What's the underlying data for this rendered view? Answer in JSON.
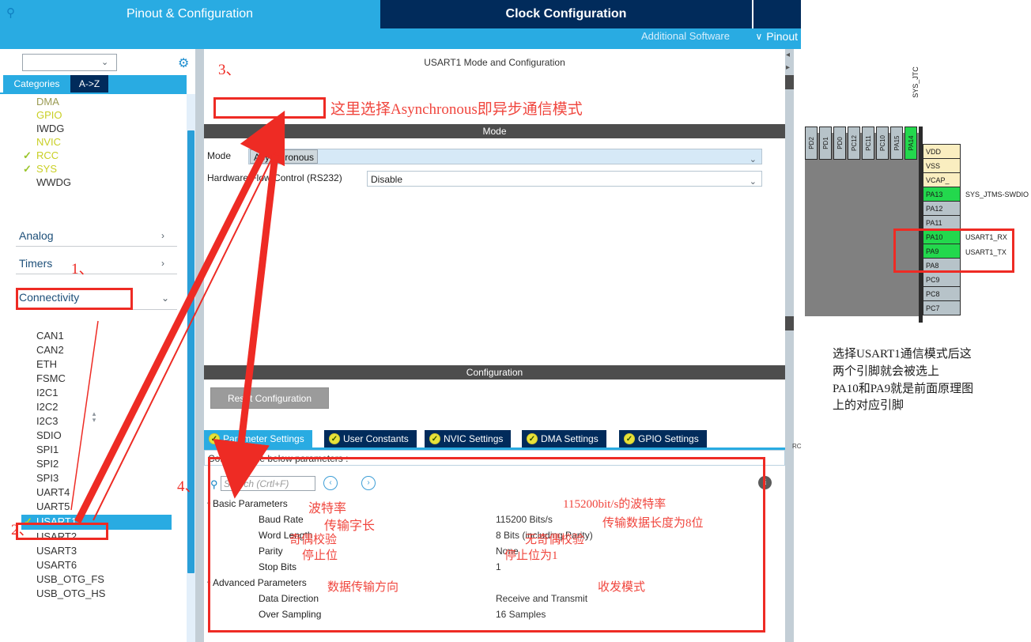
{
  "header": {
    "tabs": [
      {
        "label": "Pinout & Configuration",
        "active": true
      },
      {
        "label": "Clock Configuration",
        "active": false
      }
    ],
    "additional_software": "Additional Software",
    "pinout_dropdown": "Pinout",
    "chevron": "∨",
    "accent_blue": "#29ABE2",
    "dark_navy": "#012B5B"
  },
  "sidebar": {
    "search_icon": "search-icon",
    "search_value": "",
    "search_chevron": "⌄",
    "gear_icon": "gear-icon",
    "tabs": [
      {
        "label": "Categories",
        "active": true
      },
      {
        "label": "A->Z",
        "active": false
      }
    ],
    "peripherals": [
      {
        "label": "DMA",
        "used": false,
        "checked": false
      },
      {
        "label": "GPIO",
        "used": true,
        "checked": false
      },
      {
        "label": "IWDG",
        "used": false,
        "checked": false
      },
      {
        "label": "NVIC",
        "used": true,
        "checked": false
      },
      {
        "label": "RCC",
        "used": true,
        "checked": true
      },
      {
        "label": "SYS",
        "used": true,
        "checked": true
      },
      {
        "label": "WWDG",
        "used": false,
        "checked": false
      }
    ],
    "groups": [
      {
        "label": "Analog",
        "expanded": false,
        "chevron": "›"
      },
      {
        "label": "Timers",
        "expanded": false,
        "chevron": "›"
      },
      {
        "label": "Connectivity",
        "expanded": true,
        "chevron": "⌄"
      }
    ],
    "connectivity_items": [
      "CAN1",
      "CAN2",
      "ETH",
      "FSMC",
      "I2C1",
      "I2C2",
      "I2C3",
      "SDIO",
      "SPI1",
      "SPI2",
      "SPI3",
      "UART4",
      "UART5"
    ],
    "connectivity_selected": {
      "label": "USART1",
      "checked": true,
      "check_glyph": "✓"
    },
    "connectivity_items_after": [
      "USART2",
      "USART3",
      "USART6",
      "USB_OTG_FS",
      "USB_OTG_HS"
    ],
    "check_glyph": "✓"
  },
  "center": {
    "mode_title": "USART1 Mode and Configuration",
    "band_mode": "Mode",
    "band_config": "Configuration",
    "mode_rows": [
      {
        "label": "Mode",
        "value": "Asynchronous",
        "chevron": "⌄"
      },
      {
        "label": "Hardware Flow Control (RS232)",
        "value": "Disable",
        "chevron": "⌄"
      }
    ],
    "reset_button": "Reset Configuration",
    "config_tabs": [
      {
        "label": "Parameter Settings",
        "active": true,
        "tick": "✓"
      },
      {
        "label": "User Constants",
        "active": false,
        "tick": "✓"
      },
      {
        "label": "NVIC Settings",
        "active": false,
        "tick": "✓"
      },
      {
        "label": "DMA Settings",
        "active": false,
        "tick": "✓"
      },
      {
        "label": "GPIO Settings",
        "active": false,
        "tick": "✓"
      }
    ],
    "configure_bar": "Configure the below parameters :",
    "search_placeholder": "Search (Crtl+F)",
    "search_icon": "search-icon",
    "prev_icon": "‹",
    "next_icon": "›",
    "info_icon": "i",
    "param_groups": [
      {
        "name": "Basic Parameters",
        "chevron": "⌄",
        "rows": [
          {
            "name": "Baud Rate",
            "value": "115200 Bits/s"
          },
          {
            "name": "Word Length",
            "value": "8 Bits (including Parity)"
          },
          {
            "name": "Parity",
            "value": "None"
          },
          {
            "name": "Stop Bits",
            "value": "1"
          }
        ]
      },
      {
        "name": "Advanced Parameters",
        "chevron": "⌄",
        "rows": [
          {
            "name": "Data Direction",
            "value": "Receive and Transmit"
          },
          {
            "name": "Over Sampling",
            "value": "16 Samples"
          }
        ]
      }
    ]
  },
  "chip": {
    "sys_jtc_label": "SYS_JTC",
    "top_pins": [
      {
        "label": "PD2",
        "state": "free"
      },
      {
        "label": "PD1",
        "state": "free"
      },
      {
        "label": "PD0",
        "state": "free"
      },
      {
        "label": "PC12",
        "state": "free"
      },
      {
        "label": "PC11",
        "state": "free"
      },
      {
        "label": "PC10",
        "state": "free"
      },
      {
        "label": "PA15",
        "state": "free"
      },
      {
        "label": "PA14",
        "state": "assigned"
      }
    ],
    "right_pins": [
      {
        "label": "VDD",
        "state": "power",
        "signal": ""
      },
      {
        "label": "VSS",
        "state": "power",
        "signal": ""
      },
      {
        "label": "VCAP_",
        "state": "power",
        "signal": ""
      },
      {
        "label": "PA13",
        "state": "assigned",
        "signal": "SYS_JTMS-SWDIO"
      },
      {
        "label": "PA12",
        "state": "free",
        "signal": ""
      },
      {
        "label": "PA11",
        "state": "free",
        "signal": ""
      },
      {
        "label": "PA10",
        "state": "assigned",
        "signal": "USART1_RX"
      },
      {
        "label": "PA9",
        "state": "assigned",
        "signal": "USART1_TX"
      },
      {
        "label": "PA8",
        "state": "free",
        "signal": ""
      },
      {
        "label": "PC9",
        "state": "free",
        "signal": ""
      },
      {
        "label": "PC8",
        "state": "free",
        "signal": ""
      },
      {
        "label": "PC7",
        "state": "free",
        "signal": ""
      }
    ],
    "rc_label": "RC",
    "note": "选择USART1通信模式后这\n两个引脚就会被选上\nPA10和PA9就是前面原理图\n上的对应引脚",
    "color_assigned": "#23d84d",
    "color_free": "#b7c3c9",
    "color_power": "#faeec0",
    "color_body": "#808080"
  },
  "annotations": {
    "color": "#ee2b24",
    "steps": [
      {
        "id": "step1",
        "label": "1、"
      },
      {
        "id": "step2",
        "label": "2、"
      },
      {
        "id": "step3",
        "label": "3、"
      },
      {
        "id": "step4",
        "label": "4、"
      }
    ],
    "mode_note": "这里选择Asynchronous即异步通信模式",
    "param_notes": [
      {
        "id": "baud-name",
        "text": "波特率"
      },
      {
        "id": "baud-value",
        "text": "115200bit/s的波特率"
      },
      {
        "id": "word-name",
        "text": "传输字长"
      },
      {
        "id": "word-value",
        "text": "传输数据长度为8位"
      },
      {
        "id": "parity-name",
        "text": "奇偶校验"
      },
      {
        "id": "parity-value",
        "text": "无奇偶校验"
      },
      {
        "id": "stop-name",
        "text": "停止位"
      },
      {
        "id": "stop-value",
        "text": "停止位为1"
      },
      {
        "id": "dir-name",
        "text": "数据传输方向"
      },
      {
        "id": "dir-value",
        "text": "收发模式"
      }
    ]
  }
}
